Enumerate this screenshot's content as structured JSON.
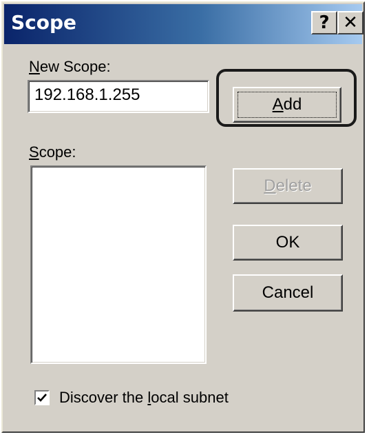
{
  "window": {
    "title": "Scope",
    "help_glyph": "?",
    "close_glyph": "✕"
  },
  "new_scope": {
    "label_accel": "N",
    "label_rest": "ew Scope:",
    "value": "192.168.1.255"
  },
  "buttons": {
    "add_accel": "A",
    "add_rest": "dd",
    "delete_accel": "D",
    "delete_rest": "elete",
    "ok": "OK",
    "cancel": "Cancel"
  },
  "scope_list": {
    "label_accel": "S",
    "label_rest": "cope:",
    "items": []
  },
  "discover": {
    "label_before": "Discover the ",
    "label_accel": "l",
    "label_after": "ocal subnet",
    "checked": true
  },
  "icons": {
    "help": "help-icon",
    "close": "close-icon",
    "check": "checkmark-icon"
  },
  "colors": {
    "titlebar_start": "#0a246a",
    "titlebar_end": "#a6caf0",
    "dialog_face": "#d4d0c8",
    "callout_border": "#1a1a1a"
  }
}
